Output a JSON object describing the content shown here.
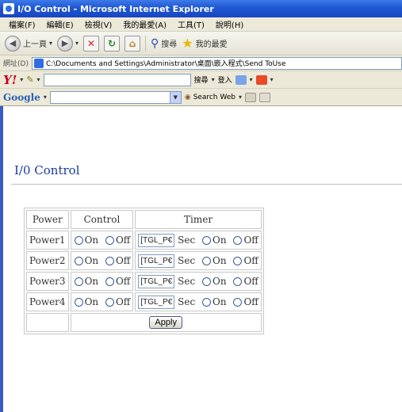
{
  "window": {
    "title": "I/O Control - Microsoft Internet Explorer"
  },
  "menu": {
    "items": [
      "檔案(F)",
      "編輯(E)",
      "檢視(V)",
      "我的最愛(A)",
      "工具(T)",
      "說明(H)"
    ]
  },
  "toolbar": {
    "back_label": "上一頁",
    "search_label": "搜尋",
    "favorites_label": "我的最愛"
  },
  "address": {
    "label": "網址(D)",
    "value": "C:\\Documents and Settings\\Administrator\\桌面\\嵌入程式\\Send ToUse"
  },
  "yahoo_bar": {
    "search_label": "搜尋",
    "login_label": "登入"
  },
  "google_bar": {
    "logo": "Google",
    "search_web_label": "Search Web"
  },
  "page": {
    "title": "I/0 Control"
  },
  "control_table": {
    "headers": [
      "Power",
      "Control",
      "Timer"
    ],
    "rows": [
      {
        "name": "Power1",
        "on": "On",
        "off": "Off",
        "timer_value": "[TGL_P€",
        "sec": "Sec",
        "on2": "On",
        "off2": "Off"
      },
      {
        "name": "Power2",
        "on": "On",
        "off": "Off",
        "timer_value": "[TGL_P€",
        "sec": "Sec",
        "on2": "On",
        "off2": "Off"
      },
      {
        "name": "Power3",
        "on": "On",
        "off": "Off",
        "timer_value": "[TGL_P€",
        "sec": "Sec",
        "on2": "On",
        "off2": "Off"
      },
      {
        "name": "Power4",
        "on": "On",
        "off": "Off",
        "timer_value": "[TGL_P€",
        "sec": "Sec",
        "on2": "On",
        "off2": "Off"
      }
    ],
    "apply_label": "Apply"
  },
  "colors": {
    "titlebar": "#1f57d1",
    "page_title": "#1a3a99",
    "chrome": "#ece9d8"
  }
}
